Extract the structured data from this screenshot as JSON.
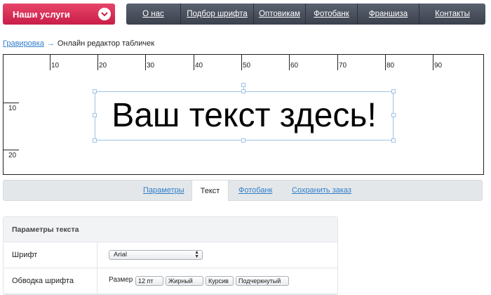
{
  "header": {
    "services_label": "Наши услуги",
    "nav": [
      "О нас",
      "Подбор шрифта",
      "Оптовикам",
      "Фотобанк",
      "Франшиза",
      "Контакты"
    ]
  },
  "breadcrumb": {
    "link": "Гравировка",
    "separator": "→",
    "current": "Онлайн редактор табличек"
  },
  "canvas": {
    "ruler_x": [
      "10",
      "20",
      "30",
      "40",
      "50",
      "60",
      "70",
      "80",
      "90"
    ],
    "ruler_y": [
      "10",
      "20"
    ],
    "text": "Ваш текст здесь!"
  },
  "tabs": [
    "Параметры",
    "Текст",
    "Фотобанк",
    "Сохранить заказ"
  ],
  "active_tab": "Текст",
  "panel": {
    "title": "Параметры текста",
    "font_label": "Шрифт",
    "font_value": "Arial",
    "second_label": "Обводка шрифта",
    "second_controls": [
      "Размер",
      "12 пт",
      "Жирный",
      "Курсив",
      "Подчеркнутый"
    ]
  },
  "colors": {
    "accent": "#c81e48",
    "nav_bg": "#3b414d",
    "link": "#2e7ec9",
    "selection": "#9ec3e6"
  }
}
